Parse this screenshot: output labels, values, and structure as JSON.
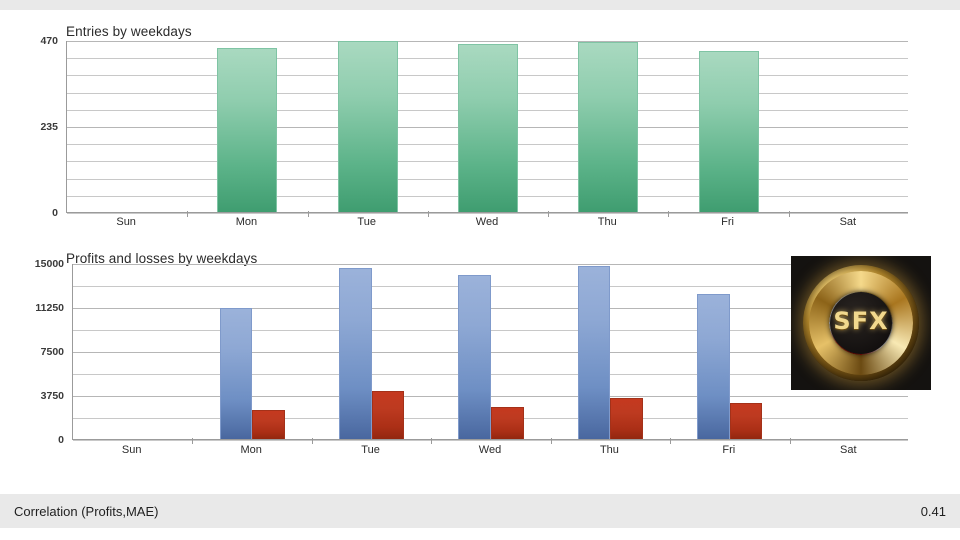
{
  "charts": [
    {
      "id": "entries",
      "title": "Entries by weekdays"
    },
    {
      "id": "profits",
      "title": "Profits and losses by weekdays"
    }
  ],
  "logo": {
    "text": "SFX",
    "name": "sfx-logo"
  },
  "statusbar": {
    "label": "Correlation (Profits,MAE)",
    "value": "0.41"
  },
  "colors": {
    "green": "#5cb389",
    "blue": "#6e8fc4",
    "red": "#bd3a20",
    "grid": "#c8c8c8",
    "axis": "#9b9b9b",
    "panel": "#e9e9e9",
    "background": "#ffffff"
  },
  "chart_data": [
    {
      "type": "bar",
      "title": "Entries by weekdays",
      "xlabel": "",
      "ylabel": "",
      "categories": [
        "Sun",
        "Mon",
        "Tue",
        "Wed",
        "Thu",
        "Fri",
        "Sat"
      ],
      "values": [
        0,
        447,
        466,
        460,
        464,
        440,
        0
      ],
      "ylim": [
        0,
        470
      ],
      "yticks": [
        0,
        235,
        470
      ],
      "ytick_labels": [
        "0",
        "235",
        "470"
      ],
      "minor_gridlines": 10,
      "grid": true,
      "legend": false,
      "series_color": "#5cb389"
    },
    {
      "type": "bar",
      "title": "Profits and losses by weekdays",
      "xlabel": "",
      "ylabel": "",
      "categories": [
        "Sun",
        "Mon",
        "Tue",
        "Wed",
        "Thu",
        "Fri",
        "Sat"
      ],
      "series": [
        {
          "name": "Profits",
          "color": "#6e8fc4",
          "values": [
            0,
            11150,
            14550,
            13950,
            14750,
            12350,
            0
          ]
        },
        {
          "name": "Losses",
          "color": "#bd3a20",
          "values": [
            0,
            2450,
            4050,
            2700,
            3500,
            3050,
            0
          ]
        }
      ],
      "ylim": [
        0,
        15000
      ],
      "yticks": [
        0,
        3750,
        7500,
        11250,
        15000
      ],
      "ytick_labels": [
        "0",
        "3750",
        "7500",
        "11250",
        "15000"
      ],
      "minor_gridlines": 8,
      "grid": true,
      "legend": false
    }
  ]
}
